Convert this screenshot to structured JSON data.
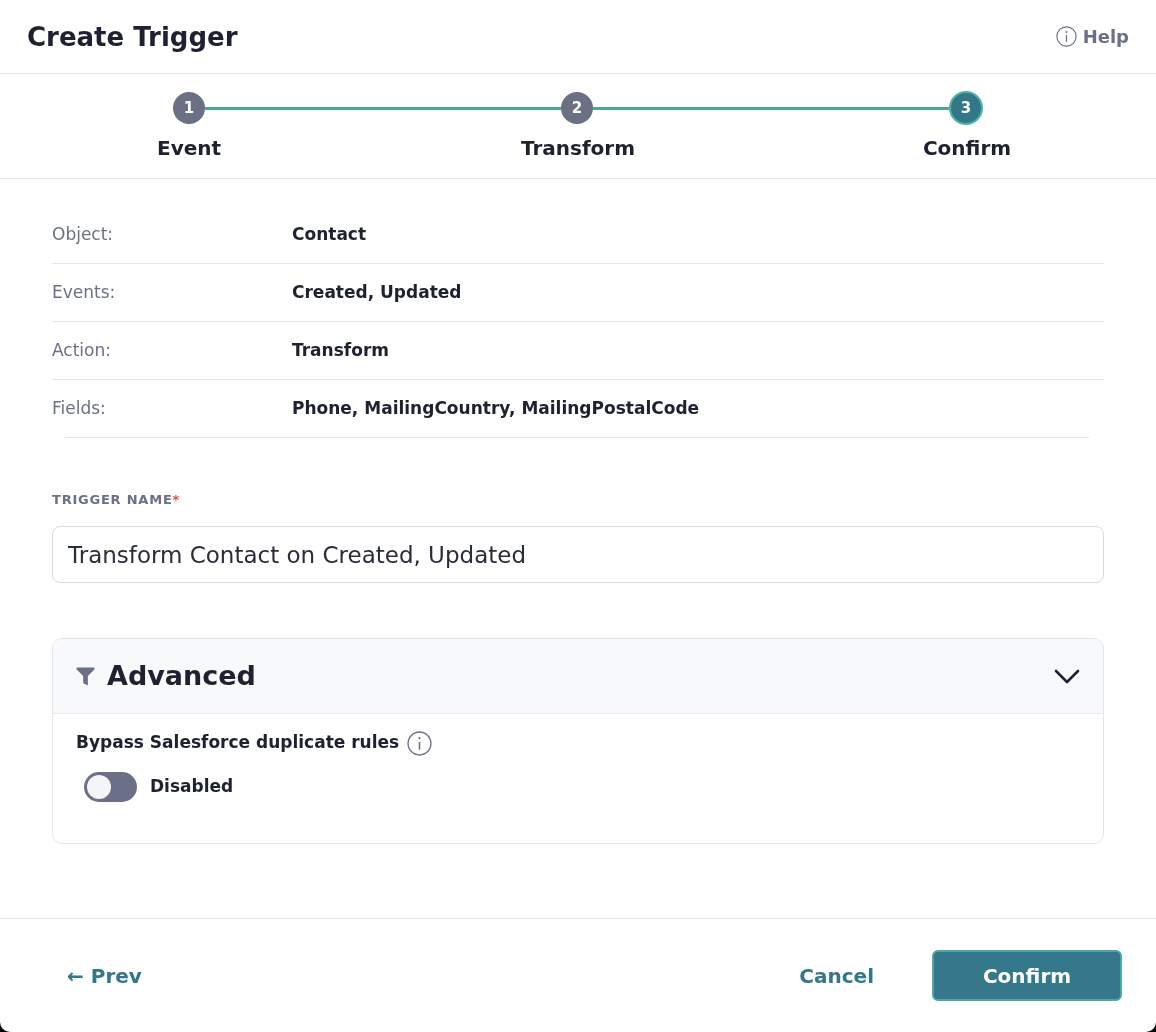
{
  "window": {
    "title": "Create Trigger",
    "help": "Help"
  },
  "steps": [
    {
      "number": "1",
      "label": "Event",
      "selected": false
    },
    {
      "number": "2",
      "label": "Transform",
      "selected": false
    },
    {
      "number": "3",
      "label": "Confirm",
      "selected": true
    }
  ],
  "summary": [
    {
      "label": "Object:",
      "value": "Contact"
    },
    {
      "label": "Events:",
      "value": "Created, Updated"
    },
    {
      "label": "Action:",
      "value": "Transform"
    },
    {
      "label": "Fields:",
      "value": "Phone, MailingCountry, MailingPostalCode"
    }
  ],
  "trigger_name": {
    "label": "TRIGGER NAME",
    "required_mark": "*",
    "value": "Transform Contact on Created, Updated"
  },
  "advanced": {
    "title": "Advanced",
    "expanded": true,
    "settings": [
      {
        "label": "Bypass Salesforce duplicate rules",
        "on": false,
        "status": "Disabled"
      }
    ]
  },
  "footer": {
    "prev": "← Prev",
    "cancel": "Cancel",
    "confirm": "Confirm"
  }
}
